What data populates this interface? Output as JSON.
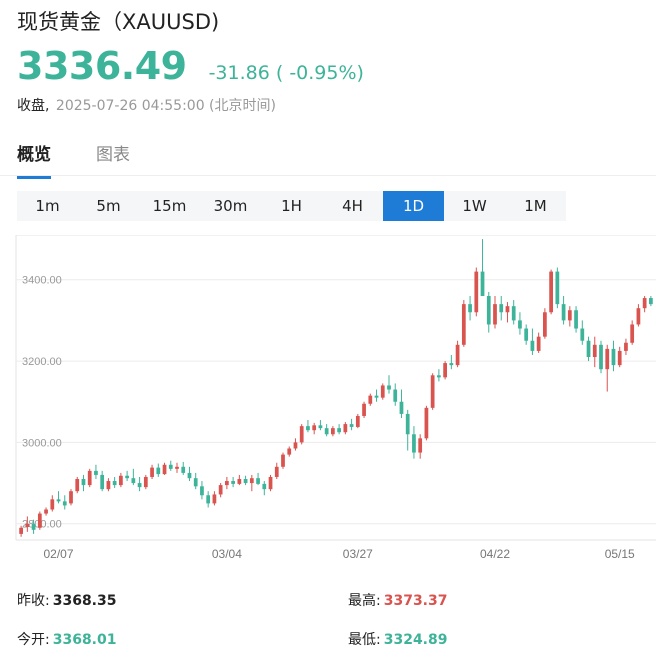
{
  "header": {
    "title": "现货黄金（XAUUSD)",
    "price": "3336.49",
    "change": "-31.86 ( -0.95%)",
    "status_label": "收盘,",
    "timestamp": "2025-07-26 04:55:00 (北京时间)"
  },
  "tabs": [
    {
      "label": "概览",
      "active": true
    },
    {
      "label": "图表",
      "active": false
    }
  ],
  "intervals": [
    {
      "label": "1m",
      "active": false
    },
    {
      "label": "5m",
      "active": false
    },
    {
      "label": "15m",
      "active": false
    },
    {
      "label": "30m",
      "active": false
    },
    {
      "label": "1H",
      "active": false
    },
    {
      "label": "4H",
      "active": false
    },
    {
      "label": "1D",
      "active": true
    },
    {
      "label": "1W",
      "active": false
    },
    {
      "label": "1M",
      "active": false
    }
  ],
  "colors": {
    "up": "#d9534f",
    "down": "#3db39a",
    "accent": "#1e7bd6"
  },
  "stats": {
    "prev_close_label": "昨收:",
    "prev_close": "3368.35",
    "high_label": "最高:",
    "high": "3373.37",
    "open_label": "今开:",
    "open": "3368.01",
    "low_label": "最低:",
    "low": "3324.89"
  },
  "chart_data": {
    "type": "candlestick",
    "y_ticks": [
      "3400.00",
      "3200.00",
      "3000.00",
      "2800.00"
    ],
    "y_tick_values": [
      3400,
      3200,
      3000,
      2800
    ],
    "x_ticks": [
      "02/07",
      "03/04",
      "03/27",
      "04/22",
      "05/15"
    ],
    "ylim": [
      2760,
      3510
    ],
    "grid": true,
    "candles": [
      [
        2775,
        2795,
        2768,
        2790
      ],
      [
        2792,
        2818,
        2780,
        2800
      ],
      [
        2800,
        2810,
        2775,
        2785
      ],
      [
        2790,
        2830,
        2785,
        2825
      ],
      [
        2825,
        2840,
        2820,
        2835
      ],
      [
        2835,
        2870,
        2830,
        2860
      ],
      [
        2860,
        2880,
        2850,
        2855
      ],
      [
        2855,
        2870,
        2835,
        2845
      ],
      [
        2850,
        2885,
        2845,
        2880
      ],
      [
        2880,
        2915,
        2875,
        2910
      ],
      [
        2910,
        2920,
        2880,
        2895
      ],
      [
        2895,
        2935,
        2890,
        2930
      ],
      [
        2930,
        2945,
        2910,
        2920
      ],
      [
        2920,
        2930,
        2880,
        2885
      ],
      [
        2885,
        2912,
        2880,
        2905
      ],
      [
        2905,
        2915,
        2888,
        2895
      ],
      [
        2895,
        2925,
        2890,
        2918
      ],
      [
        2918,
        2930,
        2905,
        2912
      ],
      [
        2912,
        2935,
        2895,
        2900
      ],
      [
        2900,
        2915,
        2880,
        2890
      ],
      [
        2890,
        2920,
        2885,
        2915
      ],
      [
        2915,
        2945,
        2910,
        2938
      ],
      [
        2938,
        2948,
        2915,
        2922
      ],
      [
        2922,
        2950,
        2920,
        2945
      ],
      [
        2945,
        2955,
        2930,
        2935
      ],
      [
        2935,
        2950,
        2925,
        2940
      ],
      [
        2940,
        2952,
        2920,
        2925
      ],
      [
        2925,
        2940,
        2905,
        2912
      ],
      [
        2912,
        2925,
        2885,
        2892
      ],
      [
        2892,
        2905,
        2860,
        2870
      ],
      [
        2870,
        2880,
        2840,
        2850
      ],
      [
        2850,
        2880,
        2845,
        2872
      ],
      [
        2872,
        2900,
        2865,
        2895
      ],
      [
        2895,
        2915,
        2885,
        2905
      ],
      [
        2905,
        2915,
        2890,
        2898
      ],
      [
        2898,
        2920,
        2895,
        2910
      ],
      [
        2910,
        2918,
        2895,
        2900
      ],
      [
        2900,
        2920,
        2880,
        2912
      ],
      [
        2912,
        2925,
        2895,
        2898
      ],
      [
        2898,
        2905,
        2870,
        2885
      ],
      [
        2885,
        2920,
        2880,
        2915
      ],
      [
        2915,
        2950,
        2910,
        2940
      ],
      [
        2940,
        2975,
        2935,
        2970
      ],
      [
        2970,
        2990,
        2965,
        2985
      ],
      [
        2985,
        3010,
        2980,
        3000
      ],
      [
        3000,
        3045,
        2995,
        3040
      ],
      [
        3040,
        3055,
        3025,
        3030
      ],
      [
        3030,
        3048,
        3020,
        3042
      ],
      [
        3042,
        3055,
        3030,
        3035
      ],
      [
        3035,
        3045,
        3015,
        3020
      ],
      [
        3020,
        3040,
        3015,
        3035
      ],
      [
        3035,
        3045,
        3020,
        3025
      ],
      [
        3025,
        3050,
        3020,
        3045
      ],
      [
        3045,
        3058,
        3030,
        3038
      ],
      [
        3038,
        3070,
        3035,
        3065
      ],
      [
        3065,
        3100,
        3060,
        3095
      ],
      [
        3095,
        3120,
        3090,
        3115
      ],
      [
        3115,
        3130,
        3100,
        3110
      ],
      [
        3110,
        3145,
        3105,
        3140
      ],
      [
        3140,
        3165,
        3120,
        3130
      ],
      [
        3130,
        3145,
        3090,
        3100
      ],
      [
        3100,
        3130,
        3060,
        3070
      ],
      [
        3070,
        3080,
        2980,
        3020
      ],
      [
        3020,
        3040,
        2960,
        2975
      ],
      [
        2975,
        3020,
        2960,
        3010
      ],
      [
        3010,
        3090,
        3005,
        3085
      ],
      [
        3085,
        3170,
        3080,
        3165
      ],
      [
        3165,
        3180,
        3150,
        3160
      ],
      [
        3160,
        3200,
        3155,
        3195
      ],
      [
        3195,
        3215,
        3180,
        3190
      ],
      [
        3190,
        3250,
        3185,
        3240
      ],
      [
        3240,
        3350,
        3235,
        3340
      ],
      [
        3340,
        3360,
        3300,
        3320
      ],
      [
        3320,
        3430,
        3310,
        3420
      ],
      [
        3420,
        3500,
        3400,
        3360
      ],
      [
        3360,
        3370,
        3270,
        3290
      ],
      [
        3290,
        3360,
        3280,
        3340
      ],
      [
        3340,
        3360,
        3300,
        3320
      ],
      [
        3320,
        3345,
        3295,
        3335
      ],
      [
        3335,
        3350,
        3290,
        3300
      ],
      [
        3300,
        3320,
        3265,
        3280
      ],
      [
        3280,
        3290,
        3240,
        3250
      ],
      [
        3250,
        3280,
        3215,
        3225
      ],
      [
        3225,
        3270,
        3220,
        3260
      ],
      [
        3260,
        3330,
        3255,
        3320
      ],
      [
        3320,
        3425,
        3315,
        3420
      ],
      [
        3420,
        3430,
        3330,
        3340
      ],
      [
        3340,
        3360,
        3290,
        3300
      ],
      [
        3300,
        3335,
        3285,
        3325
      ],
      [
        3325,
        3335,
        3270,
        3280
      ],
      [
        3280,
        3300,
        3240,
        3250
      ],
      [
        3250,
        3260,
        3200,
        3210
      ],
      [
        3210,
        3260,
        3185,
        3240
      ],
      [
        3240,
        3250,
        3170,
        3180
      ],
      [
        3180,
        3240,
        3125,
        3230
      ],
      [
        3230,
        3250,
        3175,
        3190
      ],
      [
        3190,
        3235,
        3185,
        3225
      ],
      [
        3225,
        3255,
        3215,
        3245
      ],
      [
        3245,
        3300,
        3240,
        3290
      ],
      [
        3290,
        3340,
        3285,
        3330
      ],
      [
        3330,
        3360,
        3320,
        3355
      ],
      [
        3355,
        3360,
        3335,
        3340
      ]
    ]
  }
}
